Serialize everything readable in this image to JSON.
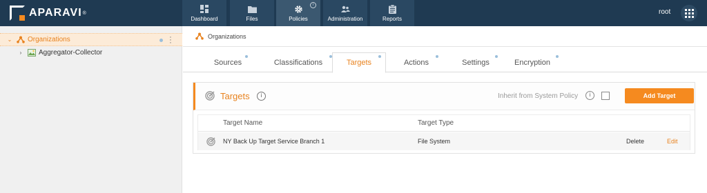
{
  "brand": {
    "name": "APARAVI",
    "reg": "®"
  },
  "nav": [
    {
      "label": "Dashboard",
      "icon": "dashboard-icon"
    },
    {
      "label": "Files",
      "icon": "folder-icon"
    },
    {
      "label": "Policies",
      "icon": "gear-icon",
      "active": true
    },
    {
      "label": "Administration",
      "icon": "users-icon"
    },
    {
      "label": "Reports",
      "icon": "clipboard-icon"
    }
  ],
  "user": {
    "name": "root"
  },
  "sidebar": {
    "items": [
      {
        "label": "Organizations",
        "selected": true
      },
      {
        "label": "Aggregator-Collector"
      }
    ]
  },
  "breadcrumb": {
    "label": "Organizations"
  },
  "tabs": [
    {
      "label": "Sources"
    },
    {
      "label": "Classifications"
    },
    {
      "label": "Targets",
      "active": true
    },
    {
      "label": "Actions"
    },
    {
      "label": "Settings"
    },
    {
      "label": "Encryption"
    }
  ],
  "panel": {
    "title": "Targets",
    "inherit_label": "Inherit from System Policy",
    "inherit_checked": false,
    "add_button": "Add Target",
    "columns": [
      "Target Name",
      "Target Type"
    ],
    "rows": [
      {
        "name": "NY Back Up Target Service Branch 1",
        "type": "File System",
        "delete": "Delete",
        "edit": "Edit"
      }
    ]
  },
  "colors": {
    "accent": "#f58a1f",
    "topbar": "#1f3a52",
    "tab_dot": "#9bbfdb"
  }
}
